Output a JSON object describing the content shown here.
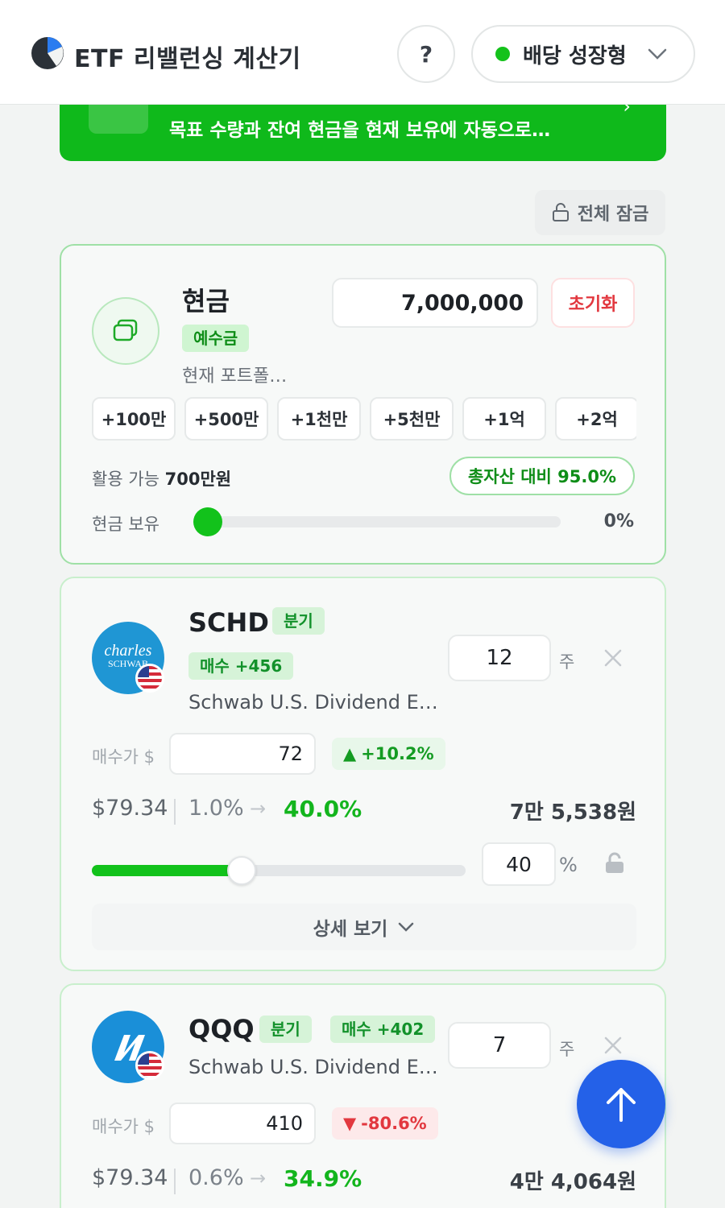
{
  "header": {
    "title": "ETF 리밸런싱 계산기",
    "help_label": "?",
    "strategy_label": "배당 성장형"
  },
  "banner": {
    "text": "목표 수량과 잔여 현금을 현재 보유에 자동으로…"
  },
  "lock_all": {
    "label": "전체 잠금"
  },
  "cash": {
    "title": "현금",
    "badge": "예수금",
    "subtitle": "현재 포트폴…",
    "amount": "7,000,000",
    "reset_label": "초기화",
    "quick_amounts": [
      "+100만",
      "+500만",
      "+1천만",
      "+5천만",
      "+1억",
      "+2억"
    ],
    "available_prefix": "활용 가능",
    "available_value": "700만원",
    "ratio_label": "총자산 대비 95.0%",
    "hold_label": "현금 보유",
    "hold_percent_text": "0%",
    "hold_fraction": 0
  },
  "holdings": [
    {
      "ticker": "SCHD",
      "frequency": "분기",
      "action": "매수 +456",
      "name": "Schwab U.S. Dividend E…",
      "logo_text": "charles SCHWAB",
      "quantity": "12",
      "quantity_unit": "주",
      "price_label": "매수가 $",
      "buy_price": "72",
      "change": "+10.2%",
      "change_dir": "up",
      "current_price": "$79.34",
      "current_weight": "1.0%",
      "target_weight": "40.0%",
      "amount": "7만 5,538원",
      "weight_input": "40",
      "weight_unit": "%",
      "weight_fraction": 0.4,
      "detail_label": "상세 보기"
    },
    {
      "ticker": "QQQ",
      "frequency": "분기",
      "action": "매수 +402",
      "name": "Schwab U.S. Dividend E…",
      "quantity": "7",
      "quantity_unit": "주",
      "price_label": "매수가 $",
      "buy_price": "410",
      "change": "-80.6%",
      "change_dir": "down",
      "current_price": "$79.34",
      "current_weight": "0.6%",
      "target_weight": "34.9%",
      "amount": "4만 4,064원"
    }
  ],
  "colors": {
    "accent_green": "#12c21b",
    "fab_blue": "#2461e8",
    "down_red": "#e2383f"
  },
  "icons": [
    "logo-icon",
    "chevron-down-icon",
    "lock-icon",
    "wallet-icon",
    "close-icon",
    "unlock-icon",
    "arrow-up-icon",
    "us-flag-icon"
  ]
}
